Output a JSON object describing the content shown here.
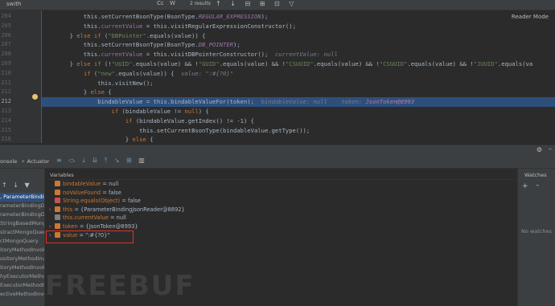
{
  "search": {
    "value": "swith",
    "results": "2 results",
    "match_case": "Cc",
    "words": "W",
    "regex": ".*"
  },
  "reader_mode": "Reader Mode",
  "editor": {
    "current_line": "212",
    "lines": [
      {
        "num": "204",
        "t": [
          [
            "plain",
            "            this.setCurrentBsonType(BsonType."
          ],
          [
            "itl",
            "REGULAR_EXPRESSION"
          ],
          [
            "plain",
            ");"
          ]
        ]
      },
      {
        "num": "205",
        "t": [
          [
            "plain",
            "            this."
          ],
          [
            "fld",
            "currentValue"
          ],
          [
            "plain",
            " = this.visitRegularExpressionConstructor();"
          ]
        ]
      },
      {
        "num": "206",
        "t": [
          [
            "plain",
            "        } "
          ],
          [
            "kw",
            "else if"
          ],
          [
            "plain",
            " ("
          ],
          [
            "str",
            "\"DBPointer\""
          ],
          [
            "plain",
            ".equals(value)) {"
          ]
        ]
      },
      {
        "num": "207",
        "t": [
          [
            "plain",
            "            this.setCurrentBsonType(BsonType."
          ],
          [
            "itl",
            "DB_POINTER"
          ],
          [
            "plain",
            ");"
          ]
        ]
      },
      {
        "num": "208",
        "t": [
          [
            "plain",
            "            this."
          ],
          [
            "fld",
            "currentValue"
          ],
          [
            "plain",
            " = this.visitDBPointerConstructor();  "
          ],
          [
            "hint",
            "currentValue: null"
          ]
        ]
      },
      {
        "num": "209",
        "t": [
          [
            "plain",
            "        } "
          ],
          [
            "kw",
            "else if"
          ],
          [
            "plain",
            " (!"
          ],
          [
            "str",
            "\"UUID\""
          ],
          [
            "plain",
            ".equals(value) && !"
          ],
          [
            "str",
            "\"GUID\""
          ],
          [
            "plain",
            ".equals(value) && !"
          ],
          [
            "str",
            "\"CSUUID\""
          ],
          [
            "plain",
            ".equals(value) && !"
          ],
          [
            "str",
            "\"CSGUID\""
          ],
          [
            "plain",
            ".equals(value) && !"
          ],
          [
            "str",
            "\"JUUID\""
          ],
          [
            "plain",
            ".equals(va"
          ]
        ]
      },
      {
        "num": "210",
        "t": [
          [
            "plain",
            "            "
          ],
          [
            "kw",
            "if"
          ],
          [
            "plain",
            " ("
          ],
          [
            "str",
            "\"new\""
          ],
          [
            "plain",
            ".equals(value)) {  "
          ],
          [
            "hint",
            "value: \":#{?0}\""
          ]
        ]
      },
      {
        "num": "211",
        "t": [
          [
            "plain",
            "                this.visitNew();"
          ]
        ]
      },
      {
        "num": "212",
        "t": [
          [
            "plain",
            "            } "
          ],
          [
            "kw",
            "else"
          ],
          [
            "plain",
            " {"
          ]
        ]
      },
      {
        "num": "212b",
        "t": [
          [
            "plain",
            "                "
          ],
          [
            "plain",
            "bindableValue = this.bindableValueFor(token);  "
          ],
          [
            "hint",
            "bindableValue: null    token: "
          ],
          [
            "hintv",
            "JsonToken@8993"
          ]
        ]
      },
      {
        "num": "213",
        "t": [
          [
            "plain",
            "                    "
          ],
          [
            "kw",
            "if"
          ],
          [
            "plain",
            " (bindableValue != "
          ],
          [
            "kw",
            "null"
          ],
          [
            "plain",
            ") {"
          ]
        ]
      },
      {
        "num": "214",
        "t": [
          [
            "plain",
            "                        "
          ],
          [
            "kw",
            "if"
          ],
          [
            "plain",
            " (bindableValue.getIndex() != -1) {"
          ]
        ]
      },
      {
        "num": "215",
        "t": [
          [
            "plain",
            "                            this.setCurrentBsonType(bindableValue.getType());"
          ]
        ]
      },
      {
        "num": "216",
        "t": [
          [
            "plain",
            "                        } "
          ],
          [
            "kw",
            "else"
          ],
          [
            "plain",
            " {"
          ]
        ]
      }
    ]
  },
  "debug": {
    "tabs": {
      "console": "onsole",
      "actuator": "Actuator"
    },
    "variables_title": "Variables",
    "watches_title": "Watches",
    "no_watches": "No watches",
    "frames": [
      ", ParameterBindin",
      "rameterBindingDo",
      "rameterBindingDocu",
      "StringBasedMongo",
      "stractMongoQuery",
      "ctMongoQuery",
      "itoryMethodInvok",
      "ositoryMethodInv",
      "itoryMethodInvok",
      "hyExecutorMethod",
      "ExecutorMethodIn",
      "ectiveMethodInvoc"
    ],
    "variables": [
      {
        "name": "bindableValue",
        "val": " = null",
        "icon": "#cc7832",
        "exp": ""
      },
      {
        "name": "noValueFound",
        "val": " = false",
        "icon": "#cc7832",
        "exp": ""
      },
      {
        "name": "String.equals(Object)",
        "val": " = false",
        "icon": "#c75450",
        "exp": ""
      },
      {
        "name": "this",
        "val": " = {ParameterBindingJsonReader@8892}",
        "icon": "#cc7832",
        "exp": "›"
      },
      {
        "name": "this.currentValue",
        "val": " = null",
        "icon": "#808080",
        "exp": ""
      },
      {
        "name": "token",
        "val": " = {JsonToken@8993}",
        "icon": "#cc7832",
        "exp": "›"
      },
      {
        "name": "value",
        "val": " = \":#{?0}\"",
        "icon": "#cc7832",
        "exp": "›"
      }
    ]
  },
  "watermark": "FREEBUF"
}
